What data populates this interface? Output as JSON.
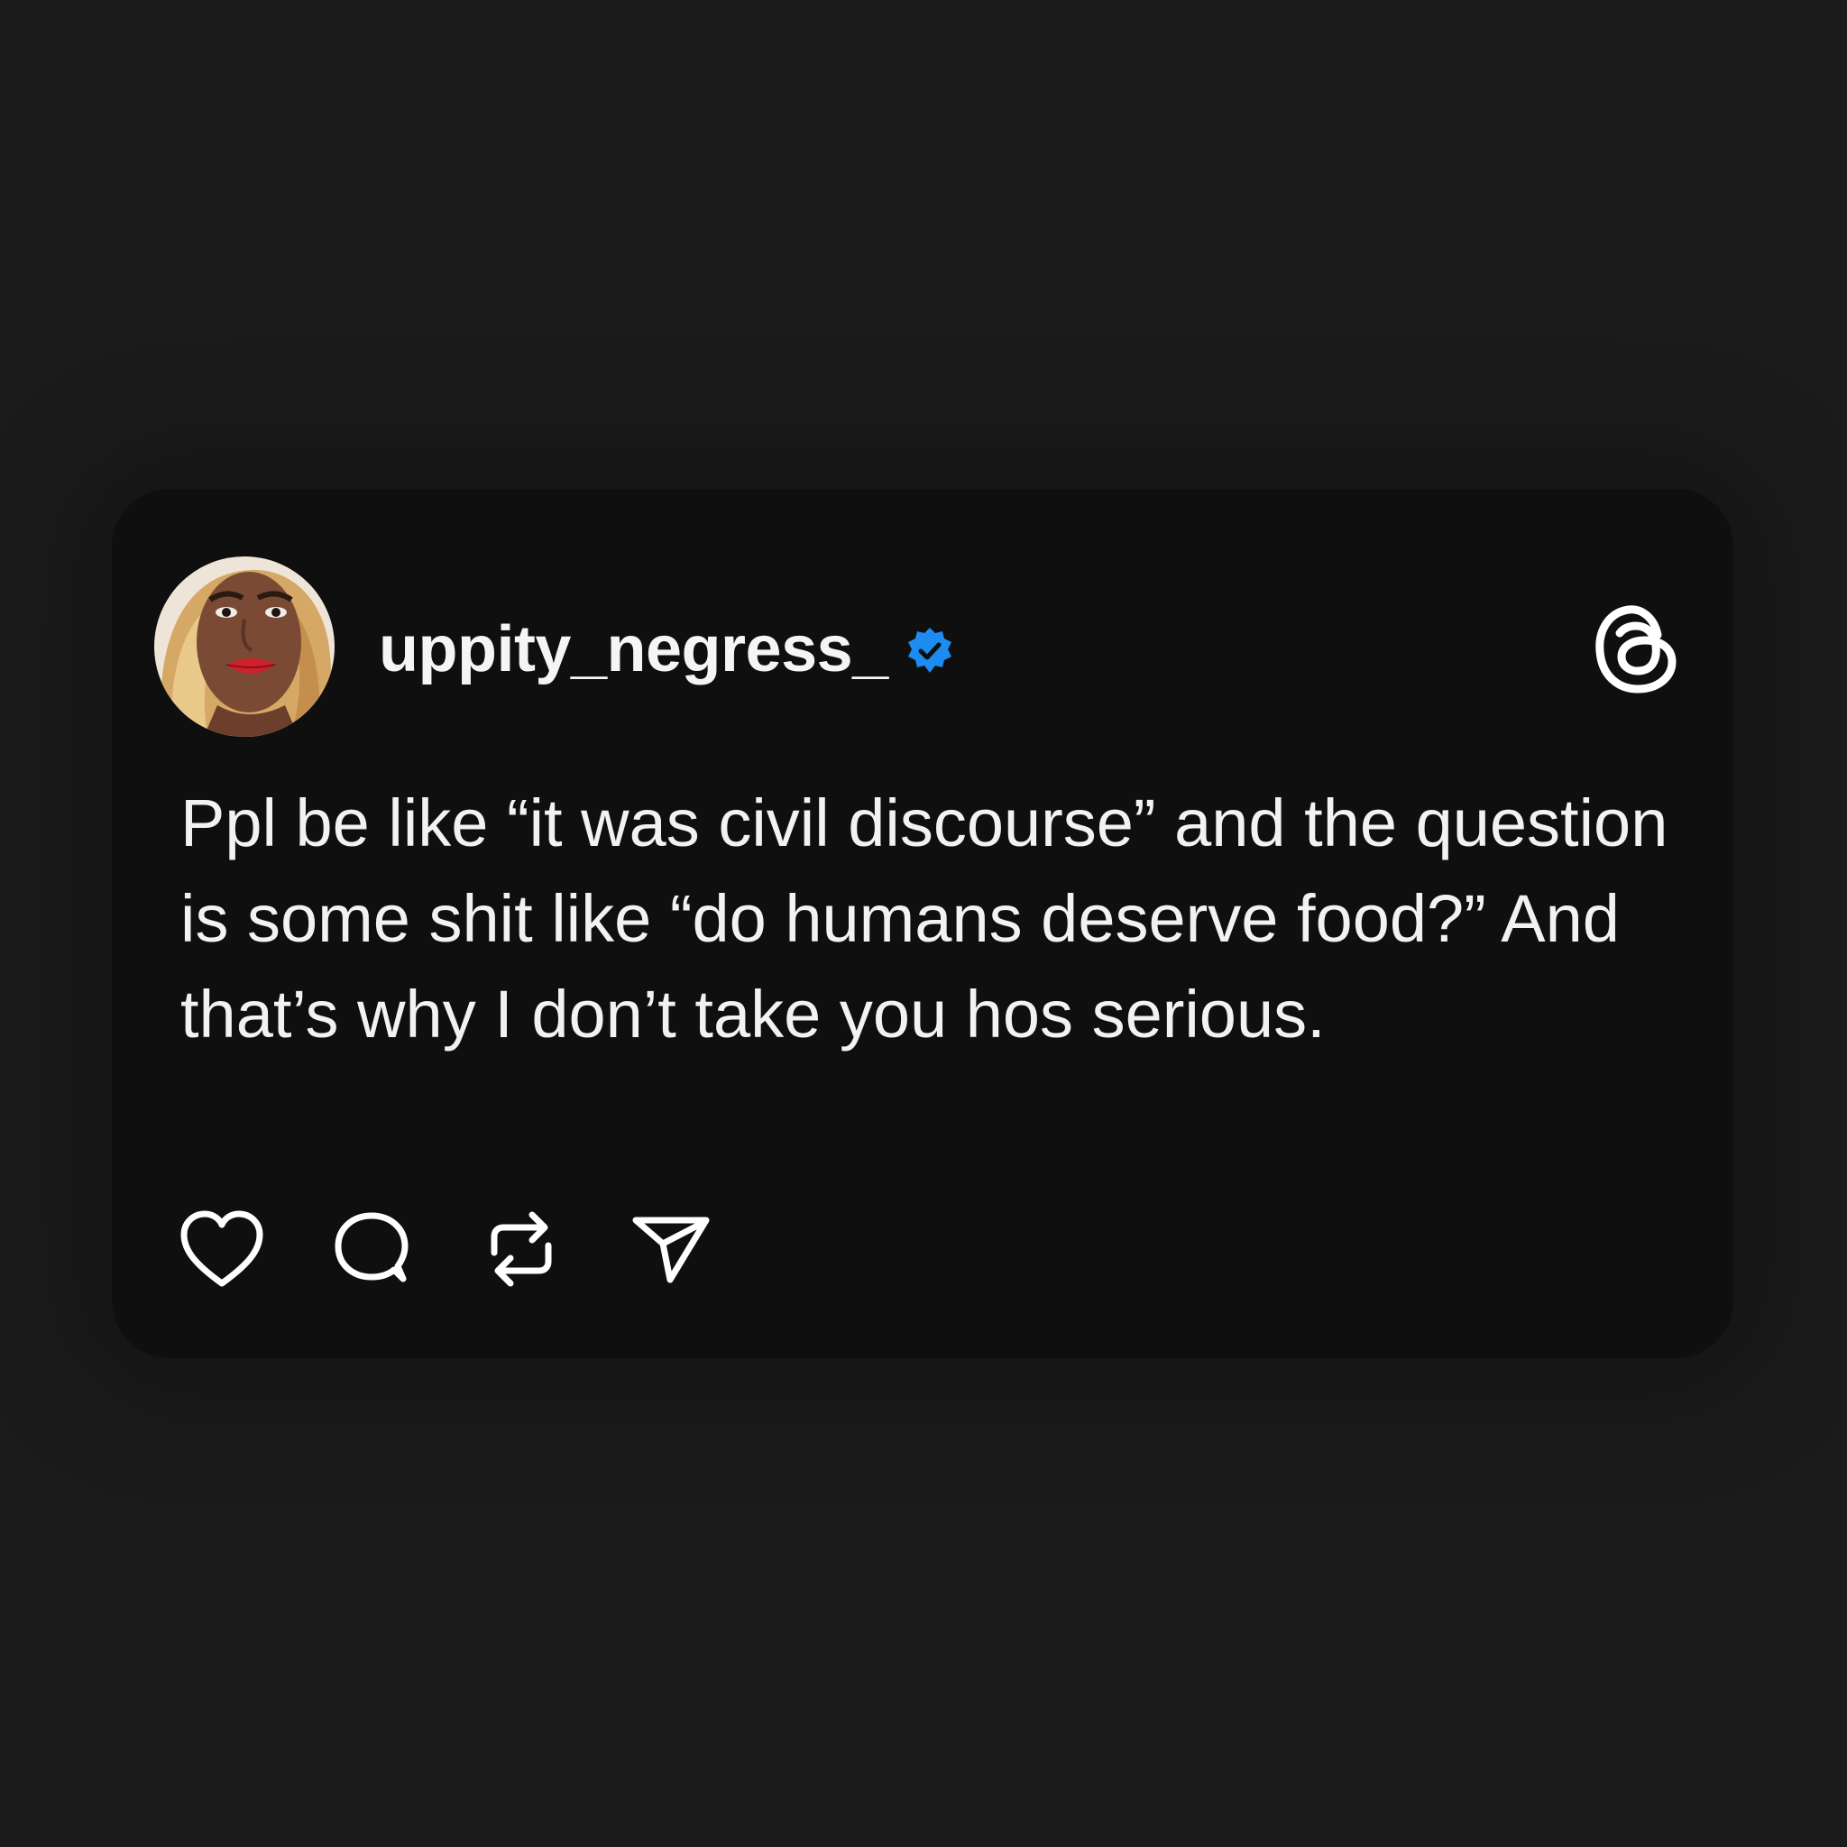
{
  "post": {
    "username": "uppity_negress_",
    "verified": true,
    "text": "Ppl be like “it was civil discourse” and the question is some shit like “do humans deserve food?” And that’s why I don’t take you hos serious."
  },
  "actions": {
    "icons": [
      "heart-icon",
      "comment-icon",
      "repost-icon",
      "share-icon"
    ]
  },
  "colors": {
    "background": "#1b1b1b",
    "card": "#0f0f0f",
    "text": "#f2f2f2",
    "verified_badge": "#1d8cf0"
  }
}
